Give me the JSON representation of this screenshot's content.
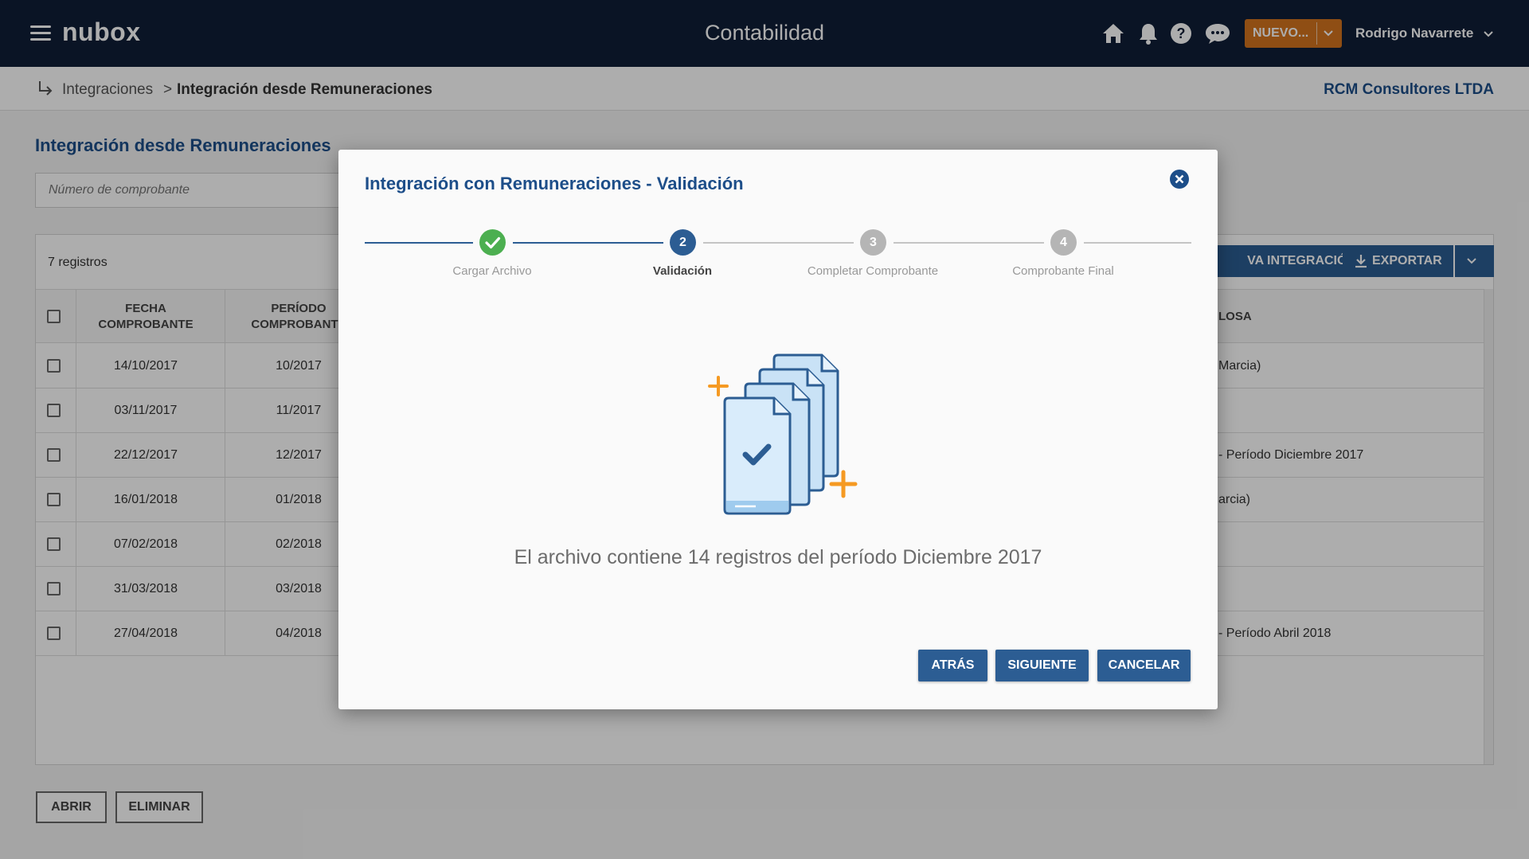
{
  "topbar": {
    "logo": "nubox",
    "app_title": "Contabilidad",
    "icons": [
      "home-icon",
      "bell-icon",
      "help-icon",
      "chat-icon"
    ],
    "nuevo_label": "NUEVO...",
    "user_name": "Rodrigo Navarrete"
  },
  "breadcrumb": {
    "items": [
      "Integraciones",
      "Integración desde Remuneraciones"
    ],
    "separator": ">",
    "company": "RCM Consultores LTDA"
  },
  "page": {
    "title": "Integración desde Remuneraciones",
    "search_placeholder": "Número de comprobante",
    "record_count": "7 registros",
    "btn_nueva_visible": "VA INTEGRACIÓN",
    "btn_exportar": "EXPORTAR",
    "columns": [
      "FECHA COMPROBANTE",
      "PERÍODO COMPROBANTE",
      "LOSA"
    ],
    "rows": [
      {
        "fecha": "14/10/2017",
        "periodo": "10/2017",
        "glosa": "Marcia)"
      },
      {
        "fecha": "03/11/2017",
        "periodo": "11/2017",
        "glosa": ""
      },
      {
        "fecha": "22/12/2017",
        "periodo": "12/2017",
        "glosa": "- Período Diciembre 2017"
      },
      {
        "fecha": "16/01/2018",
        "periodo": "01/2018",
        "glosa": "arcia)"
      },
      {
        "fecha": "07/02/2018",
        "periodo": "02/2018",
        "glosa": ""
      },
      {
        "fecha": "31/03/2018",
        "periodo": "03/2018",
        "glosa": ""
      },
      {
        "fecha": "27/04/2018",
        "periodo": "04/2018",
        "glosa": "- Período Abril 2018"
      }
    ],
    "btn_abrir": "ABRIR",
    "btn_eliminar": "ELIMINAR"
  },
  "modal": {
    "title": "Integración con Remuneraciones - Validación",
    "steps": [
      {
        "number": "1",
        "label": "Cargar Archivo",
        "state": "done"
      },
      {
        "number": "2",
        "label": "Validación",
        "state": "active"
      },
      {
        "number": "3",
        "label": "Completar Comprobante",
        "state": "pending"
      },
      {
        "number": "4",
        "label": "Comprobante Final",
        "state": "pending"
      }
    ],
    "message": "El archivo contiene 14 registros del período Diciembre 2017",
    "btn_atras": "ATRÁS",
    "btn_siguiente": "SIGUIENTE",
    "btn_cancelar": "CANCELAR"
  },
  "colors": {
    "navy": "#0f1e37",
    "primary": "#2c5d93",
    "title_blue": "#1d4e89",
    "orange": "#d3731e",
    "success": "#4caf50",
    "sparkle": "#f59a23"
  }
}
